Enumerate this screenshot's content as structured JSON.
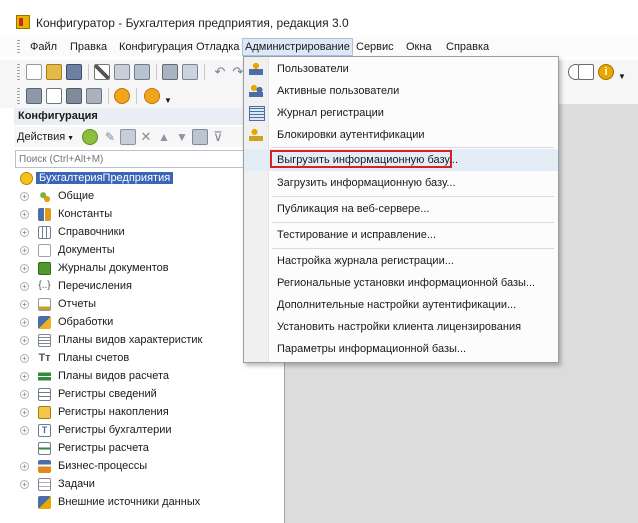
{
  "window": {
    "title": "Конфигуратор - Бухгалтерия предприятия, редакция 3.0"
  },
  "menubar": {
    "items": [
      {
        "label": "Файл"
      },
      {
        "label": "Правка"
      },
      {
        "label": "Конфигурация"
      },
      {
        "label": "Отладка"
      },
      {
        "label": "Администрирование"
      },
      {
        "label": "Сервис"
      },
      {
        "label": "Окна"
      },
      {
        "label": "Справка"
      }
    ],
    "active": "Администрирование"
  },
  "panel": {
    "title": "Конфигурация",
    "actions_label": "Действия",
    "search_placeholder": "Поиск (Ctrl+Alt+M)"
  },
  "tree": {
    "root": "БухгалтерияПредприятия",
    "items": [
      {
        "label": "Общие",
        "icon": "common-icon"
      },
      {
        "label": "Константы",
        "icon": "constants-icon"
      },
      {
        "label": "Справочники",
        "icon": "catalogs-icon"
      },
      {
        "label": "Документы",
        "icon": "documents-icon"
      },
      {
        "label": "Журналы документов",
        "icon": "journals-icon"
      },
      {
        "label": "Перечисления",
        "icon": "enums-icon"
      },
      {
        "label": "Отчеты",
        "icon": "reports-icon"
      },
      {
        "label": "Обработки",
        "icon": "processing-icon"
      },
      {
        "label": "Планы видов характеристик",
        "icon": "chart-characteristics-icon"
      },
      {
        "label": "Планы счетов",
        "icon": "chart-accounts-icon"
      },
      {
        "label": "Планы видов расчета",
        "icon": "chart-calculation-icon"
      },
      {
        "label": "Регистры сведений",
        "icon": "info-registers-icon"
      },
      {
        "label": "Регистры накопления",
        "icon": "accum-registers-icon"
      },
      {
        "label": "Регистры бухгалтерии",
        "icon": "accounting-registers-icon"
      },
      {
        "label": "Регистры расчета",
        "icon": "calc-registers-icon"
      },
      {
        "label": "Бизнес-процессы",
        "icon": "business-process-icon"
      },
      {
        "label": "Задачи",
        "icon": "tasks-icon"
      },
      {
        "label": "Внешние источники данных",
        "icon": "external-data-icon"
      }
    ]
  },
  "dropdown": {
    "items": [
      {
        "label": "Пользователи",
        "icon": "users-icon"
      },
      {
        "label": "Активные пользователи",
        "icon": "active-users-icon"
      },
      {
        "label": "Журнал регистрации",
        "icon": "event-log-icon"
      },
      {
        "label": "Блокировки аутентификации",
        "icon": "auth-lock-icon"
      },
      {
        "label": "Выгрузить информационную базу...",
        "icon": "",
        "highlighted": true
      },
      {
        "label": "Загрузить информационную базу...",
        "icon": ""
      },
      {
        "label": "Публикация на веб-сервере...",
        "icon": ""
      },
      {
        "label": "Тестирование и исправление...",
        "icon": ""
      },
      {
        "label": "Настройка журнала регистрации...",
        "icon": ""
      },
      {
        "label": "Региональные установки информационной базы...",
        "icon": ""
      },
      {
        "label": "Дополнительные настройки аутентификации...",
        "icon": ""
      },
      {
        "label": "Установить настройки клиента лицензирования",
        "icon": ""
      },
      {
        "label": "Параметры информационной базы...",
        "icon": ""
      }
    ]
  },
  "colors": {
    "highlight_border": "#d42323",
    "selection": "#3b66b7"
  }
}
